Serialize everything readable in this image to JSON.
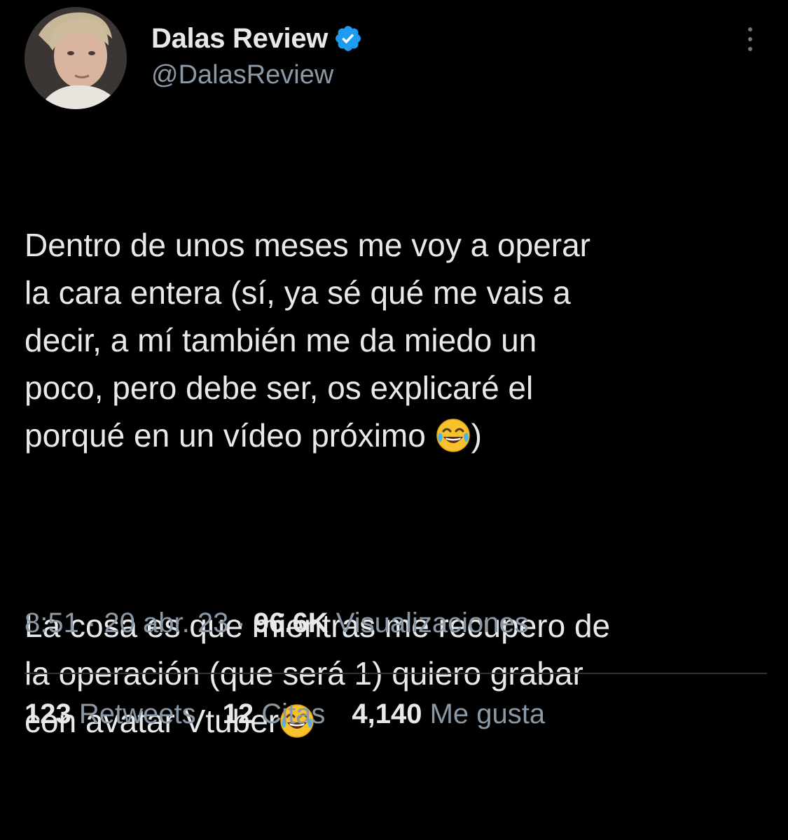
{
  "author": {
    "display_name": "Dalas Review",
    "handle": "@DalasReview",
    "verified_color": "#1d9bf0"
  },
  "tweet": {
    "paragraph1": {
      "line1": "Dentro de unos meses me voy a operar",
      "line2": "la cara entera (sí, ya sé qué me vais a",
      "line3": "decir, a mí también me da miedo un",
      "line4": "poco, pero debe ser, os explicaré el",
      "line5_before_emoji": "porqué en un vídeo próximo ",
      "line5_after_emoji": ")"
    },
    "paragraph2": {
      "line1": "La cosa es que mientras me recupero de",
      "line2": "la operación (que será 1) quiero grabar",
      "line3_before_emoji": "con avatar Vtuber",
      "line3_after_emoji": ""
    },
    "emoji_name": "face-with-tears-of-joy"
  },
  "meta": {
    "time": "8:51",
    "separator": " · ",
    "date": "20 abr. 23",
    "views_count": "96.6K",
    "views_label": " Visualizaciones"
  },
  "stats": {
    "retweets_count": "123",
    "retweets_label": " Retweets",
    "quotes_count": "12",
    "quotes_label": " Citas",
    "likes_count": "4,140",
    "likes_label": " Me gusta"
  },
  "colors": {
    "background": "#000000",
    "primary_text": "#e7e9ea",
    "secondary_text": "#8b98a5",
    "divider": "#2f3336"
  }
}
